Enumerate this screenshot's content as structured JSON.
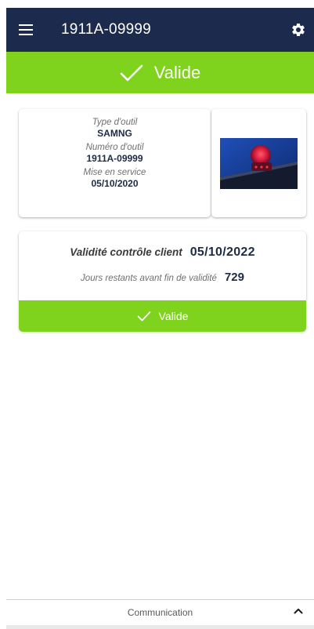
{
  "app_bar": {
    "title": "1911A-09999",
    "menu_icon": "hamburger-menu-icon",
    "settings_icon": "gear-icon"
  },
  "status_banner": {
    "label": "Valide",
    "icon": "checkmark-icon"
  },
  "tool_info": {
    "type_label": "Type d'outil",
    "type_value": "SAMNG",
    "number_label": "Numéro d'outil",
    "number_value": "1911A-09999",
    "service_label": "Mise en service",
    "service_value": "05/10/2020"
  },
  "validity": {
    "control_label": "Validité contrôle client",
    "control_date": "05/10/2022",
    "remaining_label": "Jours restants avant fin de validité",
    "remaining_days": "729",
    "button_label": "Valide"
  },
  "footer": {
    "label": "Communication",
    "icon": "chevron-up-icon"
  },
  "colors": {
    "app_bar": "#1b2a4d",
    "valid_green": "#7fd31d",
    "value_text": "#1c2b46"
  }
}
